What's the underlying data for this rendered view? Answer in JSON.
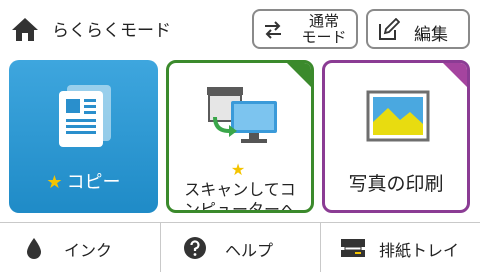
{
  "header": {
    "home_icon": "home-icon",
    "title": "らくらくモード",
    "mode_button": {
      "line1": "通常",
      "line2": "モード",
      "icon": "swap-arrows-icon"
    },
    "edit_button": {
      "label": "編集",
      "icon": "edit-pencil-icon"
    }
  },
  "tiles": [
    {
      "id": "copy",
      "star": "★",
      "label": "コピー",
      "icon": "copy-document-icon",
      "color": "#2a97d3"
    },
    {
      "id": "scan",
      "star": "★",
      "line1": "スキャンしてコ",
      "line2": "ンピューターへ",
      "icon": "scan-to-computer-icon",
      "color": "#3b8a2c"
    },
    {
      "id": "photo",
      "label": "写真の印刷",
      "icon": "photo-icon",
      "color": "#8b3c94"
    }
  ],
  "bottom_bar": [
    {
      "label": "インク",
      "icon": "ink-drop-icon"
    },
    {
      "label": "ヘルプ",
      "icon": "help-icon"
    },
    {
      "label": "排紙トレイ",
      "icon": "output-tray-icon"
    }
  ],
  "colors": {
    "star": "#f4c400",
    "border": "#8a8a8a"
  }
}
